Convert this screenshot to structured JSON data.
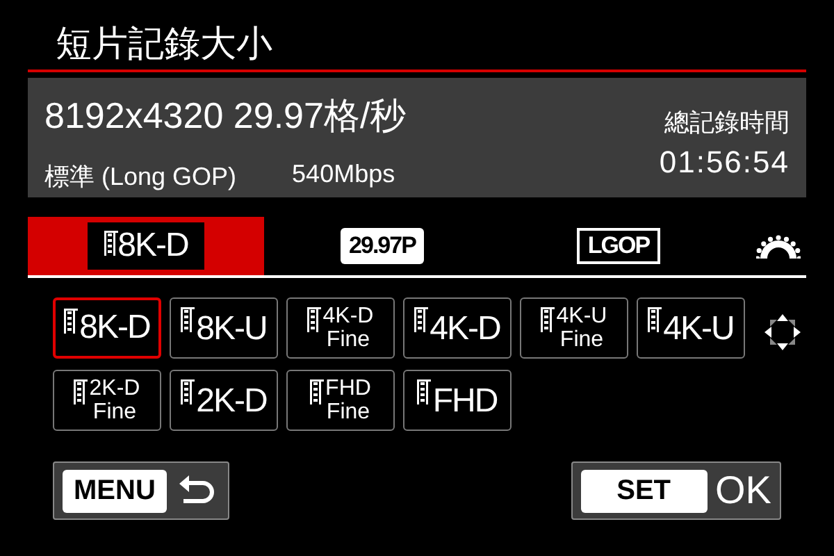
{
  "title": "短片記錄大小",
  "info": {
    "resolution": "8192x4320 29.97格/秒",
    "quality": "標準 (Long GOP)",
    "bitrate": "540Mbps",
    "total_label": "總記錄時間",
    "total_time": "01:56:54"
  },
  "tabs": [
    {
      "label": "8K-D",
      "kind": "size",
      "selected": true
    },
    {
      "label": "29.97P",
      "kind": "framerate",
      "selected": false
    },
    {
      "label": "LGOP",
      "kind": "compression",
      "selected": false
    }
  ],
  "options": [
    {
      "label": "8K-D",
      "kind": "plain",
      "selected": true
    },
    {
      "label": "8K-U",
      "kind": "plain",
      "selected": false
    },
    {
      "label": "4K-D",
      "sub": "Fine",
      "kind": "fine",
      "selected": false
    },
    {
      "label": "4K-D",
      "kind": "plain",
      "selected": false
    },
    {
      "label": "4K-U",
      "sub": "Fine",
      "kind": "fine",
      "selected": false
    },
    {
      "label": "4K-U",
      "kind": "plain",
      "selected": false
    },
    {
      "label": "2K-D",
      "sub": "Fine",
      "kind": "fine",
      "selected": false
    },
    {
      "label": "2K-D",
      "kind": "plain",
      "selected": false
    },
    {
      "label": "FHD",
      "sub": "Fine",
      "kind": "fine",
      "selected": false
    },
    {
      "label": "FHD",
      "kind": "plain",
      "selected": false
    }
  ],
  "buttons": [
    {
      "key": "MENU",
      "kind": "back"
    },
    {
      "key": "SET",
      "label": "OK",
      "kind": "ok"
    }
  ]
}
